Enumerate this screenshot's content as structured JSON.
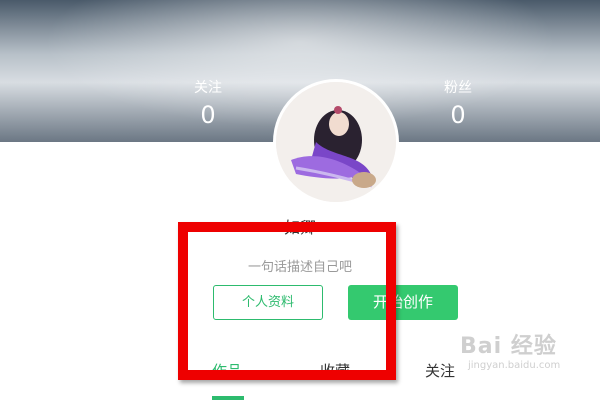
{
  "stats": {
    "follow": {
      "label": "关注",
      "count": "0"
    },
    "fans": {
      "label": "粉丝",
      "count": "0"
    }
  },
  "profile": {
    "username": "如卿",
    "bio": "一句话描述自己吧"
  },
  "actions": {
    "profile_label": "个人资料",
    "create_label": "开始创作"
  },
  "tabs": [
    {
      "label": "作品",
      "active": true
    },
    {
      "label": "收藏",
      "active": false
    },
    {
      "label": "关注",
      "active": false
    }
  ],
  "watermark": {
    "main": "Bai 经验",
    "sub": "jingyan.baidu.com"
  },
  "colors": {
    "accent": "#2dbb6e",
    "primary_button": "#34c96f",
    "highlight": "#ee0000"
  },
  "icons": {
    "avatar": "anime-girl-avatar"
  }
}
